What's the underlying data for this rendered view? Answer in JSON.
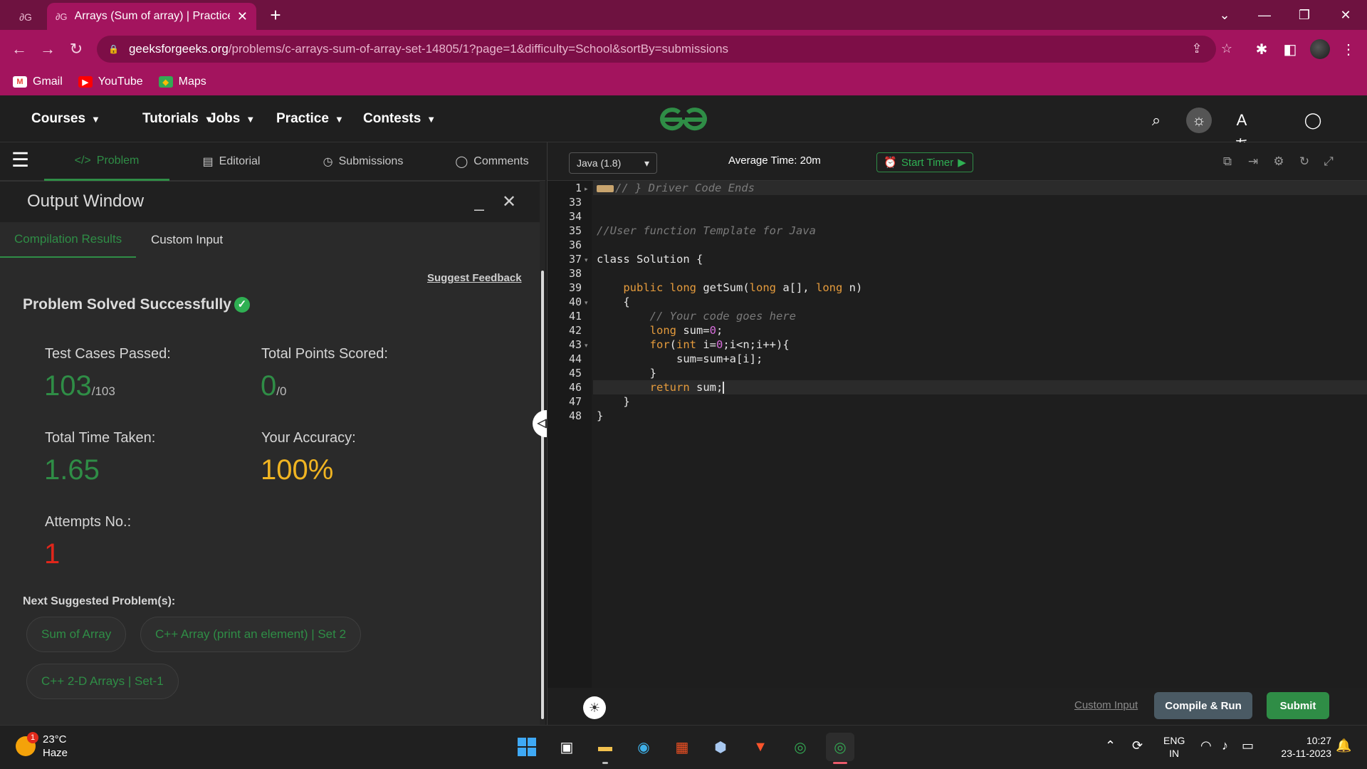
{
  "browser": {
    "inactive_tab_icon": "gfg-favicon",
    "active_tab": {
      "favicon": "gfg-favicon",
      "title": "Arrays (Sum of array) | Practice |"
    },
    "url_host": "geeksforgeeks.org",
    "url_path": "/problems/c-arrays-sum-of-array-set-14805/1?page=1&difficulty=School&sortBy=submissions",
    "bookmarks": [
      {
        "label": "Gmail",
        "icon": "gmail-icon",
        "color": "#ea4335"
      },
      {
        "label": "YouTube",
        "icon": "youtube-icon",
        "color": "#ff0000"
      },
      {
        "label": "Maps",
        "icon": "maps-icon",
        "color": "#34a853"
      }
    ]
  },
  "site_nav": {
    "items": [
      "Courses",
      "Tutorials",
      "Jobs",
      "Practice",
      "Contests"
    ],
    "logo_text": "GG"
  },
  "problem_tabs": [
    {
      "label": "Problem",
      "icon": "code-icon",
      "active": true
    },
    {
      "label": "Editorial",
      "icon": "document-icon"
    },
    {
      "label": "Submissions",
      "icon": "clock-icon"
    },
    {
      "label": "Comments",
      "icon": "comment-icon"
    }
  ],
  "output_window": {
    "title": "Output Window",
    "tabs": [
      "Compilation Results",
      "Custom Input"
    ],
    "suggest_feedback": "Suggest Feedback",
    "status": "Problem Solved Successfully",
    "test_cases_label": "Test Cases Passed:",
    "test_cases_value": "103",
    "test_cases_total": "/103",
    "points_label": "Total Points Scored:",
    "points_value": "0",
    "points_total": "/0",
    "time_label": "Total Time Taken:",
    "time_value": "1.65",
    "accuracy_label": "Your Accuracy:",
    "accuracy_value": "100%",
    "attempts_label": "Attempts No.:",
    "attempts_value": "1",
    "next_label": "Next Suggested Problem(s):",
    "suggested": [
      "Sum of Array",
      "C++ Array (print an element) | Set 2",
      "C++ 2-D Arrays | Set-1"
    ]
  },
  "editor": {
    "language": "Java (1.8)",
    "average_time": "Average Time: 20m",
    "timer_label": "Start Timer",
    "line_numbers": [
      "1",
      "33",
      "34",
      "35",
      "36",
      "37",
      "38",
      "39",
      "40",
      "41",
      "42",
      "43",
      "44",
      "45",
      "46",
      "47",
      "48"
    ],
    "lines": {
      "l1": "// } Driver Code Ends",
      "l35": "//User function Template for Java",
      "l37_kw": "class",
      "l37_rest": " Solution {",
      "l39_pub": "public",
      "l39_long": "long",
      "l39_mid": " getSum(",
      "l39_long2": "long",
      "l39_mid2": " a[], ",
      "l39_long3": "long",
      "l39_end": " n)",
      "l40": "{",
      "l41": "// Your code goes here",
      "l42_kw": "long",
      "l42_a": " sum=",
      "l42_num": "0",
      "l42_b": ";",
      "l43_kw": "for",
      "l43_a": "(",
      "l43_int": "int",
      "l43_b": " i=",
      "l43_num": "0",
      "l43_c": ";i<n;i++){",
      "l44": "sum=sum+a[i];",
      "l45": "}",
      "l46_kw": "return",
      "l46_rest": " sum;",
      "l47": "}",
      "l48": "}"
    },
    "custom_input": "Custom Input",
    "compile_run": "Compile & Run",
    "submit": "Submit"
  },
  "taskbar": {
    "weather_temp": "23°C",
    "weather_desc": "Haze",
    "weather_badge": "1",
    "lang_top": "ENG",
    "lang_bottom": "IN",
    "time": "10:27",
    "date": "23-11-2023"
  },
  "colors": {
    "accent": "#2f8d46",
    "chrome": "#a3145e",
    "accuracy": "#f0b422",
    "attempts": "#e0261b"
  }
}
